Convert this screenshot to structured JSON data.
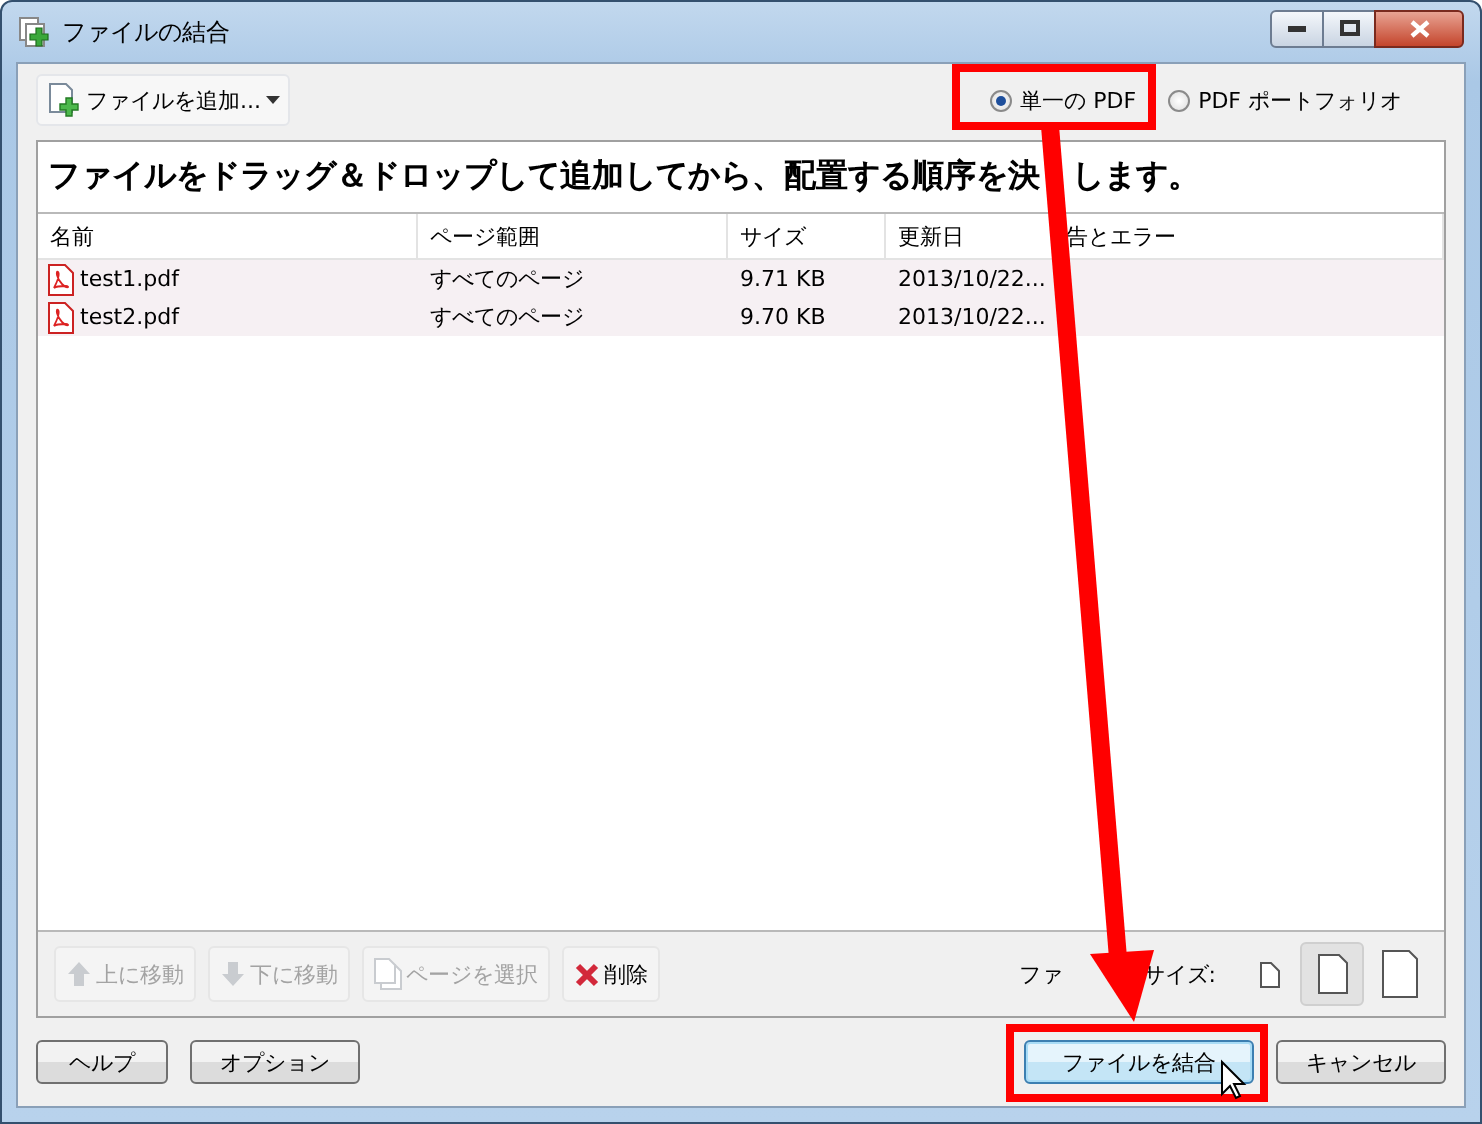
{
  "window": {
    "title": "ファイルの結合"
  },
  "add_button": {
    "label": "ファイルを追加..."
  },
  "output_mode": [
    {
      "label": "単一の PDF",
      "selected": true
    },
    {
      "label": "PDF ポートフォリオ",
      "selected": false
    }
  ],
  "instruction": [
    "ファイルをドラッグ＆ドロップして追加してから、配置する順序を決",
    "します。"
  ],
  "table": {
    "columns": [
      "名前",
      "ページ範囲",
      "サイズ",
      "更新日",
      "告とエラー"
    ],
    "rows": [
      {
        "cells": [
          "test1.pdf",
          "すべてのページ",
          "9.71 KB",
          "2013/10/22..."
        ]
      },
      {
        "cells": [
          "test2.pdf",
          "すべてのページ",
          "9.70 KB",
          "2013/10/22..."
        ]
      }
    ]
  },
  "actions": [
    {
      "kind": "up",
      "label": "上に移動",
      "disabled": true
    },
    {
      "kind": "down",
      "label": "下に移動",
      "disabled": true
    },
    {
      "kind": "pages",
      "label": "ページを選択",
      "disabled": true
    },
    {
      "kind": "delete",
      "label": "削除",
      "disabled": false
    }
  ],
  "thumbnail_size": {
    "label_parts": [
      "ファ",
      "サイズ:"
    ],
    "options": [
      {
        "kind": "small",
        "selected": false
      },
      {
        "kind": "medium",
        "selected": true
      },
      {
        "kind": "large",
        "selected": false
      }
    ]
  },
  "left_buttons": [
    {
      "label": "ヘルプ",
      "default": false
    },
    {
      "label": "オプション",
      "default": false
    }
  ],
  "right_buttons": [
    {
      "label": "ファイルを結合",
      "default": true
    },
    {
      "label": "キャンセル",
      "default": false
    }
  ]
}
